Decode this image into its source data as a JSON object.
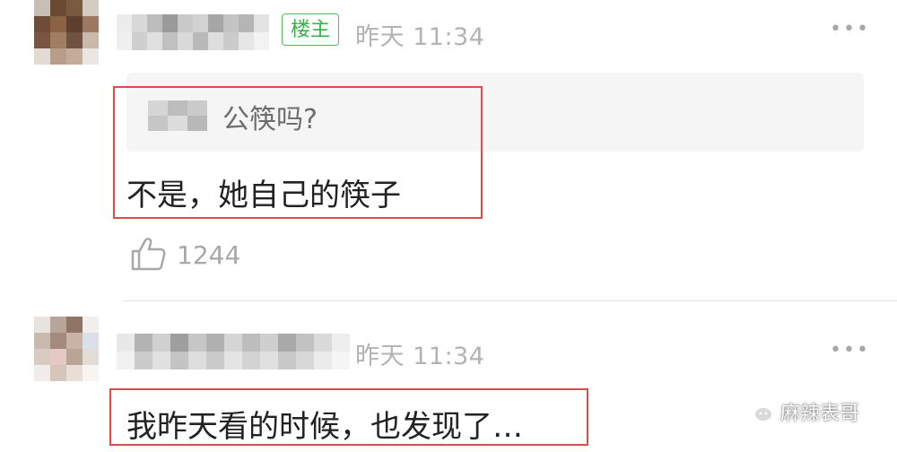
{
  "comments": [
    {
      "badge": "楼主",
      "time": "昨天 11:34",
      "more": "•••",
      "quote": {
        "text": "公筷吗?"
      },
      "text": "不是，她自己的筷子",
      "likes": "1244"
    },
    {
      "time": "昨天 11:34",
      "more": "•••",
      "text": "我昨天看的时候，也发现了…"
    }
  ],
  "watermark": {
    "text": "麻辣表哥",
    "icon": "wechat-icon"
  },
  "colors": {
    "badge_green": "#34b244",
    "highlight_red": "#e04a4a",
    "muted_gray": "#b3b3b3"
  }
}
